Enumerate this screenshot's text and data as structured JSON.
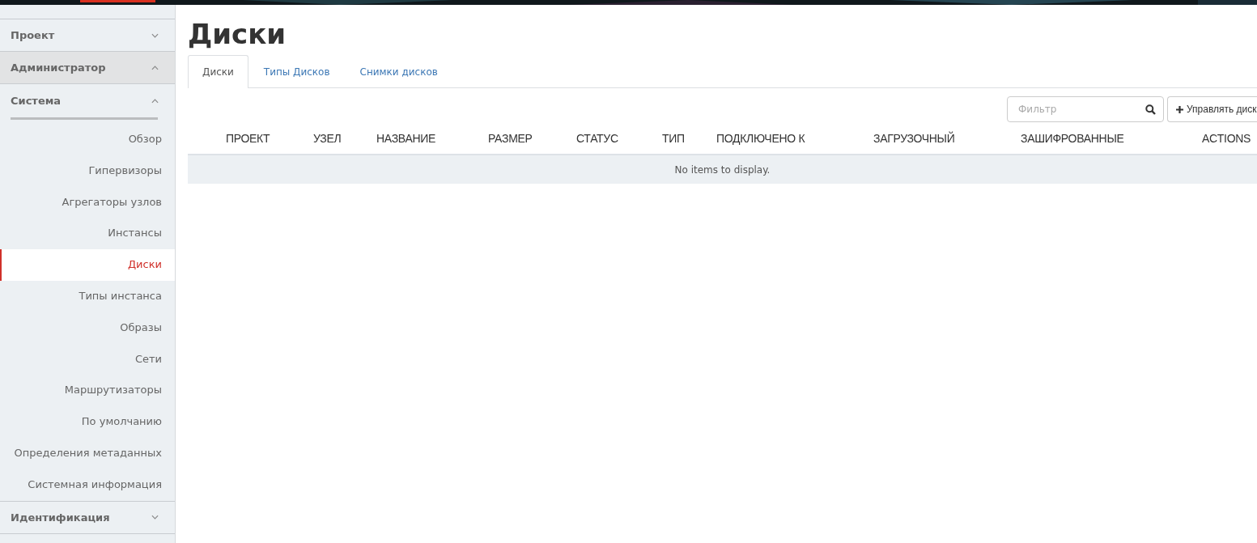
{
  "sidebar": {
    "sections": [
      {
        "label": "Проект",
        "expanded": false,
        "kind": "dashboard"
      },
      {
        "label": "Администратор",
        "expanded": true,
        "kind": "dashboard"
      },
      {
        "label": "Система",
        "expanded": true,
        "kind": "panel",
        "items": [
          {
            "label": "Обзор",
            "selected": false
          },
          {
            "label": "Гипервизоры",
            "selected": false
          },
          {
            "label": "Агрегаторы узлов",
            "selected": false
          },
          {
            "label": "Инстансы",
            "selected": false
          },
          {
            "label": "Диски",
            "selected": true
          },
          {
            "label": "Типы инстанса",
            "selected": false
          },
          {
            "label": "Образы",
            "selected": false
          },
          {
            "label": "Сети",
            "selected": false
          },
          {
            "label": "Маршрутизаторы",
            "selected": false
          },
          {
            "label": "По умолчанию",
            "selected": false
          },
          {
            "label": "Определения метаданных",
            "selected": false
          },
          {
            "label": "Системная информация",
            "selected": false
          }
        ]
      },
      {
        "label": "Идентификация",
        "expanded": false,
        "kind": "dashboard"
      }
    ]
  },
  "page": {
    "title": "Диски"
  },
  "tabs": [
    {
      "label": "Диски",
      "selected": true
    },
    {
      "label": "Типы Дисков",
      "selected": false
    },
    {
      "label": "Снимки дисков",
      "selected": false
    }
  ],
  "filter": {
    "placeholder": "Фильтр"
  },
  "manage_button": {
    "label": "Управлять диск"
  },
  "table": {
    "columns": [
      "ПРОЕКТ",
      "УЗЕЛ",
      "НАЗВАНИЕ",
      "РАЗМЕР",
      "СТАТУС",
      "ТИП",
      "ПОДКЛЮЧЕНО К",
      "ЗАГРУЗОЧНЫЙ",
      "ЗАШИФРОВАННЫЕ",
      "ACTIONS"
    ],
    "empty_message": "No items to display."
  }
}
